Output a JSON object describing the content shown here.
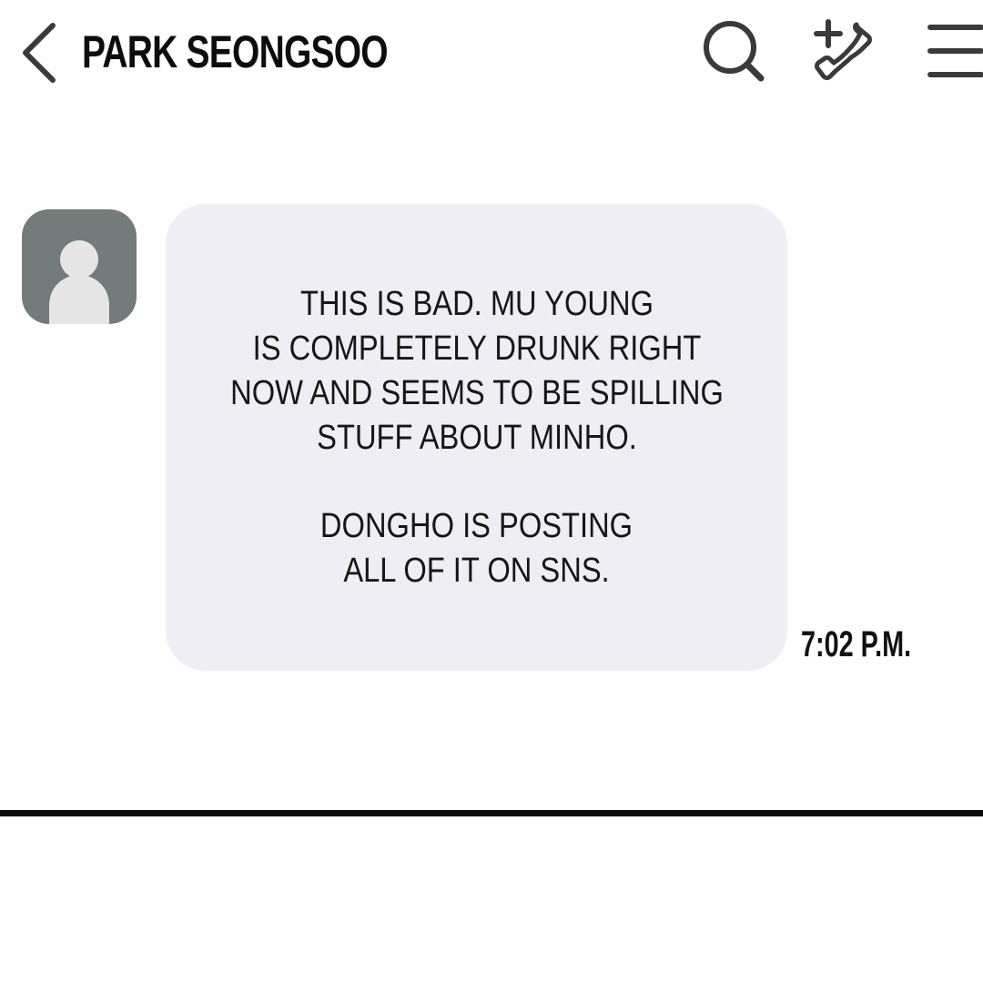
{
  "header": {
    "title": "PARK SEONGSOO",
    "back_icon": "chevron-left-icon",
    "search_icon": "search-icon",
    "add_call_icon": "add-call-icon",
    "menu_icon": "menu-icon"
  },
  "message": {
    "sender_avatar": "default-user-avatar",
    "paragraphs": [
      "THIS IS BAD. MU YOUNG\nIS COMPLETELY DRUNK RIGHT\nNOW AND SEEMS TO BE SPILLING\nSTUFF ABOUT MINHO.",
      "DONGHO IS POSTING\nALL OF IT ON SNS."
    ],
    "timestamp": "7:02 P.M."
  },
  "colors": {
    "bubble": "#efeef4",
    "avatar_bg": "#737b7b",
    "avatar_figure": "#e6e6e6",
    "icon_stroke": "#3a3a3a",
    "text": "#111111"
  }
}
